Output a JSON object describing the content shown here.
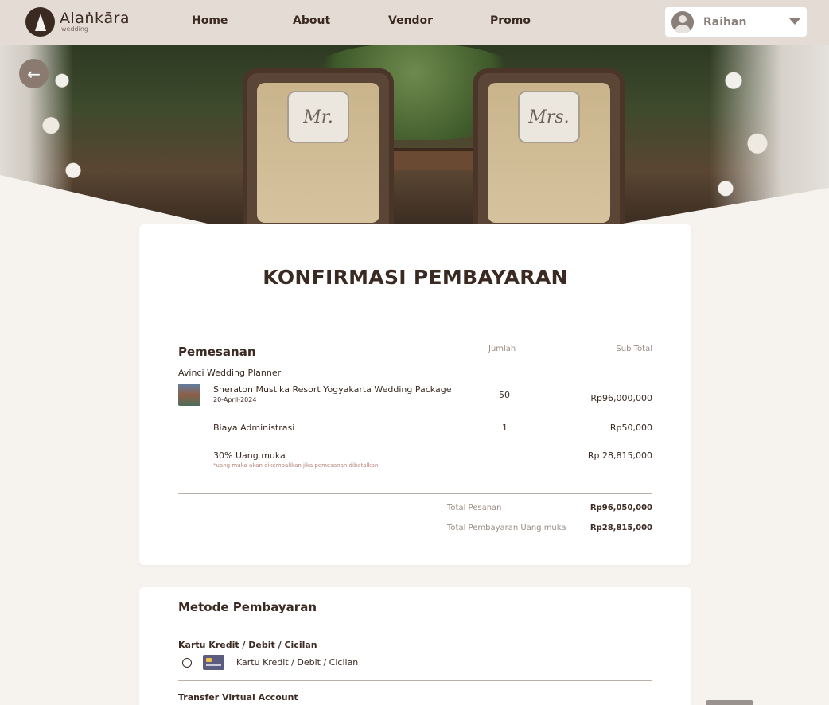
{
  "header": {
    "logo_name": "Alaṅkāra",
    "logo_sub": "wedding",
    "nav": [
      "Home",
      "About",
      "Vendor",
      "Promo"
    ],
    "user_name": "Raihan"
  },
  "hero": {
    "sign_left": "Mr.",
    "sign_right": "Mrs."
  },
  "confirmation": {
    "title": "KONFIRMASI PEMBAYARAN",
    "section_title": "Pemesanan",
    "col_qty": "Jumlah",
    "col_subtotal": "Sub Total",
    "vendor": "Avinci Wedding Planner",
    "items": [
      {
        "name": "Sheraton Mustika Resort Yogyakarta Wedding Package",
        "date": "20-April-2024",
        "qty": "50",
        "subtotal": "Rp96,000,000"
      },
      {
        "name": "Biaya Administrasi",
        "qty": "1",
        "subtotal": "Rp50,000"
      },
      {
        "name": "30% Uang muka",
        "note": "*uang muka akan dikembalikan jika pemesanan dibatalkan",
        "subtotal": "Rp 28,815,000"
      }
    ],
    "total_label": "Total Pesanan",
    "total_value": "Rp96,050,000",
    "dp_label": "Total Pembayaran Uang muka",
    "dp_value": "Rp28,815,000"
  },
  "payment": {
    "title": "Metode Pembayaran",
    "group1": "Kartu Kredit / Debit / Cicilan",
    "option1": "Kartu Kredit / Debit / Cicilan",
    "group2": "Transfer Virtual Account"
  },
  "colors": {
    "brand_dark": "#3b2a22",
    "header_bg": "#e4dcd4",
    "page_bg": "#f6f3ee"
  }
}
